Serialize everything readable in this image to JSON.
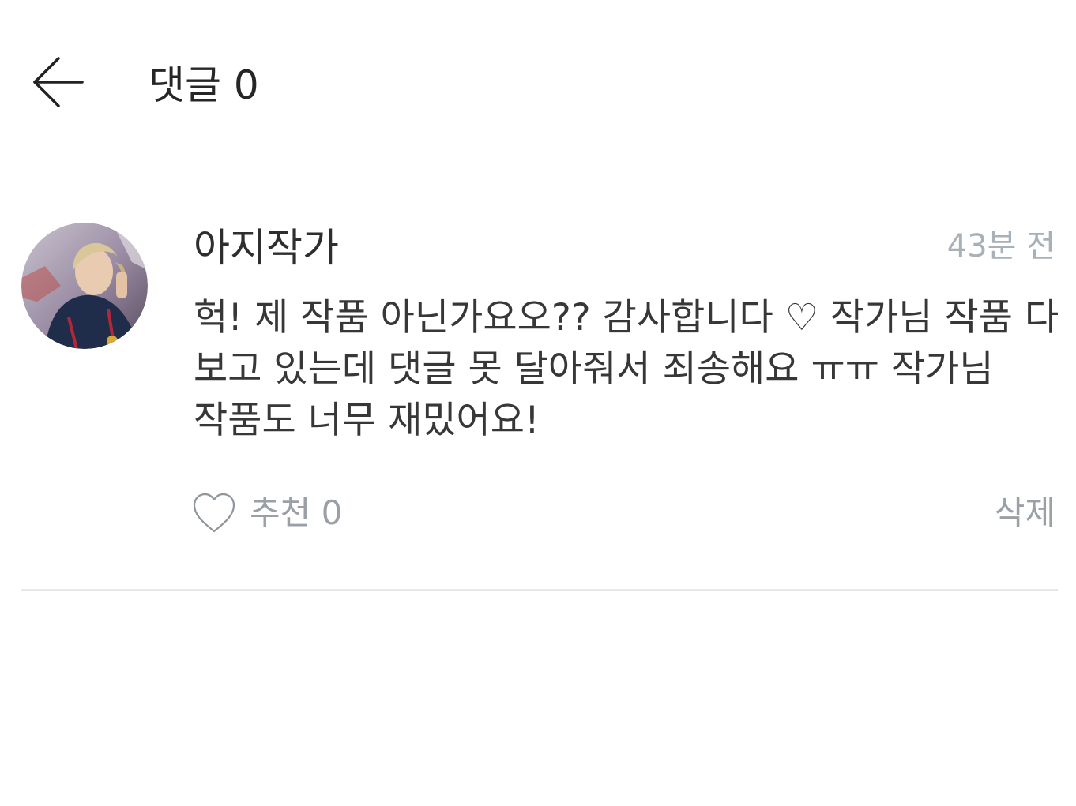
{
  "header": {
    "title": "댓글 0",
    "back_icon": "arrow-left-icon"
  },
  "comment": {
    "author": "아지작가",
    "timestamp": "43분 전",
    "body": "헉! 제 작품 아닌가요오?? 감사합니다 ♡ 작가님 작품 다 보고 있는데 댓글 못 달아줘서 죄송해요 ㅠㅠ 작가님 작품도 너무 재밌어요!",
    "avatar_icon": "avatar-photo",
    "like": {
      "icon": "heart-outline-icon",
      "label": "추천 0"
    },
    "delete_label": "삭제"
  },
  "colors": {
    "text_primary": "#262626",
    "text_muted": "#9aa0a6",
    "timestamp": "#a8b1b8",
    "divider": "#e6e8ea"
  }
}
